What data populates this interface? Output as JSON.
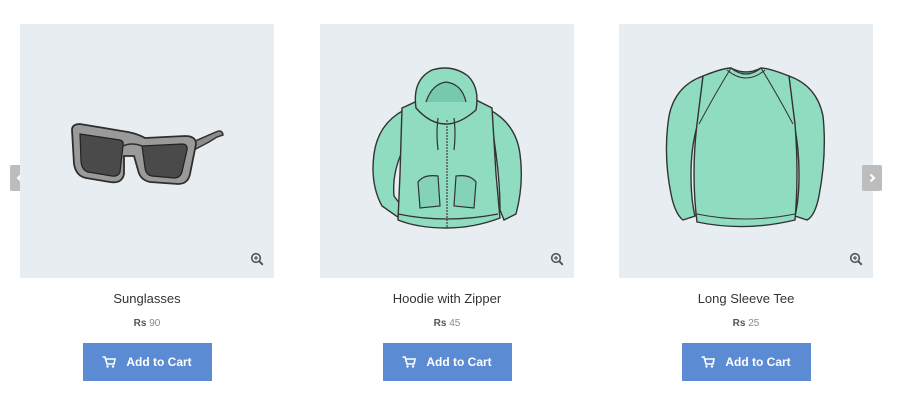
{
  "products": [
    {
      "name": "Sunglasses",
      "currency": "Rs",
      "price": "90",
      "button_label": "Add to Cart",
      "icon": "sunglasses-image"
    },
    {
      "name": "Hoodie with Zipper",
      "currency": "Rs",
      "price": "45",
      "button_label": "Add to Cart",
      "icon": "hoodie-image"
    },
    {
      "name": "Long Sleeve Tee",
      "currency": "Rs",
      "price": "25",
      "button_label": "Add to Cart",
      "icon": "long-sleeve-tee-image"
    }
  ],
  "icons": {
    "carousel_prev": "chevron-left-icon",
    "carousel_next": "chevron-right-icon",
    "zoom": "zoom-in-icon",
    "cart": "cart-icon"
  },
  "colors": {
    "button": "#5b8bd2",
    "image_bg": "#e8edf2",
    "apparel": "#8fdcc1",
    "arrow_bg": "#bdbdbd"
  }
}
